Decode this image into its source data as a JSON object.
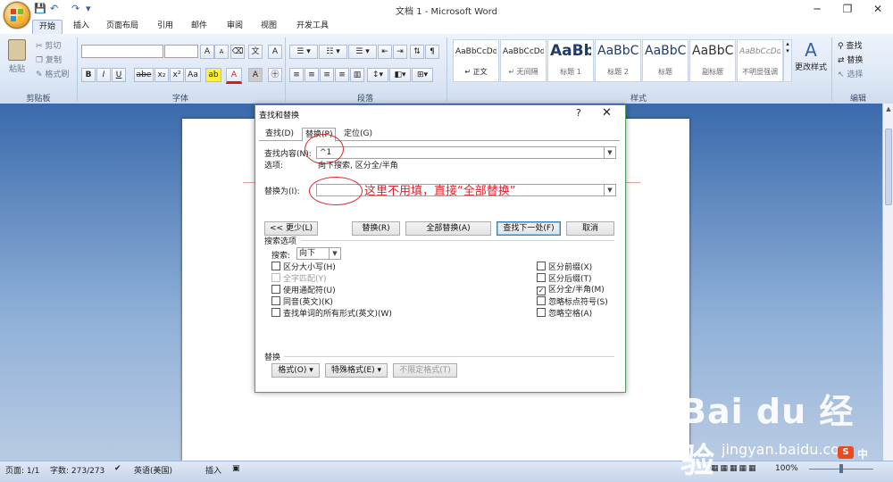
{
  "window": {
    "title": "文档 1 - Microsoft Word",
    "controls": [
      "─",
      "❐",
      "✕"
    ]
  },
  "qat": {
    "save": "💾",
    "undo": "↶",
    "redo": "↷",
    "customize": "▾"
  },
  "tabs": [
    "开始",
    "插入",
    "页面布局",
    "引用",
    "邮件",
    "审阅",
    "视图",
    "开发工具"
  ],
  "active_tab": "开始",
  "ribbon": {
    "clipboard": {
      "label": "剪贴板",
      "paste": "粘贴",
      "cut": "剪切",
      "copy": "复制",
      "format_painter": "格式刷"
    },
    "font": {
      "label": "字体",
      "grow": "A",
      "shrink": "A",
      "bold": "B",
      "italic": "I",
      "underline": "U",
      "strike": "abe",
      "sub": "x₂",
      "sup": "x²",
      "case": "Aa",
      "color": "A",
      "char_border": "A"
    },
    "paragraph": {
      "label": "段落"
    },
    "styles": {
      "label": "样式",
      "items": [
        {
          "preview": "AaBbCcDd",
          "name": "↵ 正文"
        },
        {
          "preview": "AaBbCcDd",
          "name": "↵ 无间隔"
        },
        {
          "preview": "AaBb",
          "name": "标题 1"
        },
        {
          "preview": "AaBbC",
          "name": "标题 2"
        },
        {
          "preview": "AaBbC",
          "name": "标题"
        },
        {
          "preview": "AaBbC",
          "name": "副标题"
        },
        {
          "preview": "AaBbCcDd",
          "name": "不明显强调"
        }
      ],
      "change_styles": "更改样式"
    },
    "editing": {
      "label": "编辑",
      "find": "查找",
      "replace": "替换",
      "select": "选择"
    }
  },
  "dialog": {
    "title": "查找和替换",
    "help": "?",
    "close": "✕",
    "tabs": [
      "查找(D)",
      "替换(P)",
      "定位(G)"
    ],
    "find_label": "查找内容(N):",
    "find_value": "^1",
    "options_label": "选项:",
    "options_value": "向下搜索, 区分全/半角",
    "replace_label": "替换为(I):",
    "replace_value": "",
    "annotation": "这里不用填，直接“全部替换”",
    "buttons": {
      "less": "<< 更少(L)",
      "replace": "替换(R)",
      "replace_all": "全部替换(A)",
      "find_next": "查找下一处(F)",
      "cancel": "取消"
    },
    "search_options_title": "搜索选项",
    "search_label": "搜索:",
    "search_value": "向下",
    "left_checks": [
      {
        "label": "区分大小写(H)",
        "checked": false,
        "disabled": false
      },
      {
        "label": "全字匹配(Y)",
        "checked": false,
        "disabled": true
      },
      {
        "label": "使用通配符(U)",
        "checked": false,
        "disabled": false
      },
      {
        "label": "同音(英文)(K)",
        "checked": false,
        "disabled": false
      },
      {
        "label": "查找单词的所有形式(英文)(W)",
        "checked": false,
        "disabled": false
      }
    ],
    "right_checks": [
      {
        "label": "区分前缀(X)",
        "checked": false
      },
      {
        "label": "区分后缀(T)",
        "checked": false
      },
      {
        "label": "区分全/半角(M)",
        "checked": true
      },
      {
        "label": "忽略标点符号(S)",
        "checked": false
      },
      {
        "label": "忽略空格(A)",
        "checked": false
      }
    ],
    "replace_section": "替换",
    "format_btn": "格式(O) ▾",
    "special_btn": "特殊格式(E) ▾",
    "noformat_btn": "不限定格式(T)"
  },
  "status": {
    "page": "页面: 1/1",
    "words": "字数: 273/273",
    "language": "英语(美国)",
    "insert": "插入",
    "zoom": "100%"
  },
  "watermark": {
    "brand": "Bai du 经验",
    "url": "jingyan.baidu.com",
    "ime": "中"
  }
}
